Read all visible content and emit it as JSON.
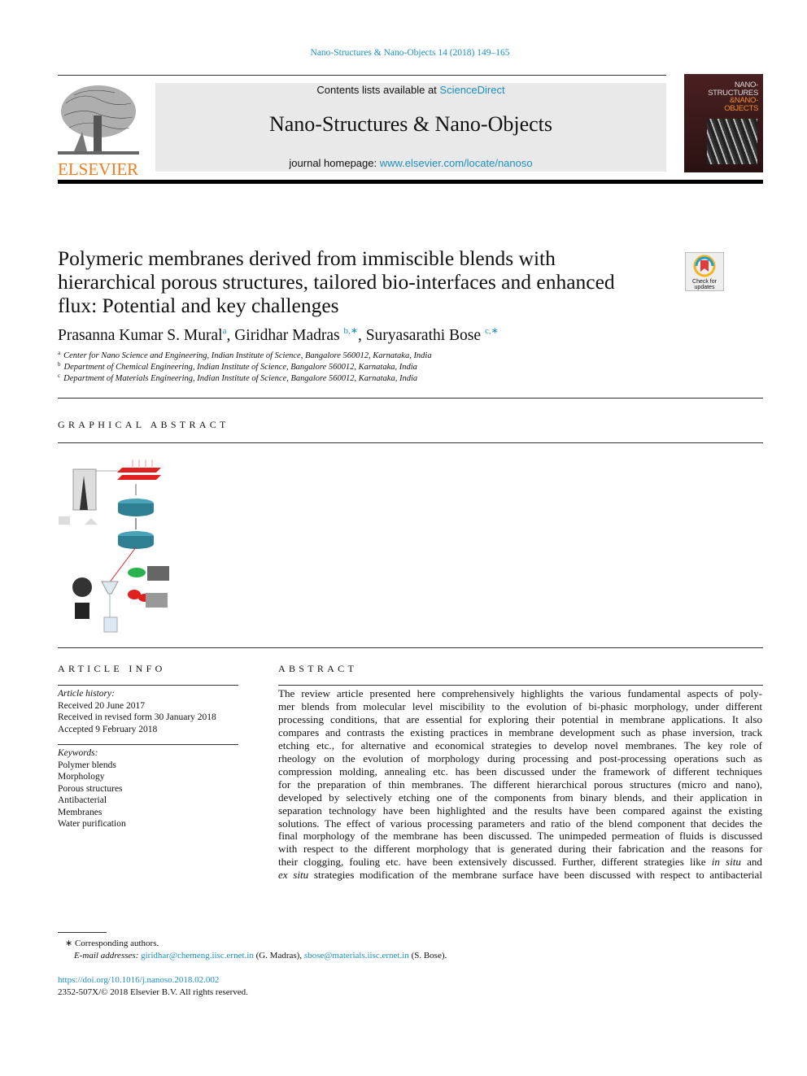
{
  "header": {
    "citation": "Nano-Structures & Nano-Objects 14 (2018) 149–165",
    "contents_prefix": "Contents lists available at ",
    "contents_link": "ScienceDirect",
    "journal_title": "Nano-Structures & Nano-Objects",
    "homepage_prefix": "journal homepage: ",
    "homepage_link": "www.elsevier.com/locate/nanoso",
    "publisher_logo_text": "ELSEVIER",
    "cover_text": [
      "NANO-",
      "STRUCTURES",
      "&NANO-",
      "OBJECTS"
    ],
    "brand_orange": "#f07c1e",
    "link_color": "#1d8fc0"
  },
  "article": {
    "title_lines": [
      "Polymeric membranes derived from immiscible blends with",
      "hierarchical porous structures, tailored bio-interfaces and enhanced",
      "flux: Potential and key challenges"
    ],
    "check_updates": [
      "Check for",
      "updates"
    ],
    "authors": [
      {
        "name": "Prasanna Kumar S. Mural",
        "sup": "a"
      },
      {
        "name": "Giridhar Madras",
        "sup": "b,∗"
      },
      {
        "name": "Suryasarathi Bose",
        "sup": "c,∗"
      }
    ],
    "affiliations": [
      {
        "key": "a",
        "text": "Center for Nano Science and Engineering, Indian Institute of Science, Bangalore 560012, Karnataka, India"
      },
      {
        "key": "b",
        "text": "Department of Chemical Engineering, Indian Institute of Science, Bangalore 560012, Karnataka, India"
      },
      {
        "key": "c",
        "text": "Department of Materials Engineering, Indian Institute of Science, Bangalore 560012, Karnataka, India"
      }
    ]
  },
  "graphical_abstract": {
    "heading": "GRAPHICAL ABSTRACT"
  },
  "article_info": {
    "heading": "ARTICLE INFO",
    "history_label": "Article history:",
    "history": [
      "Received 20 June 2017",
      "Received in revised form 30 January 2018",
      "Accepted 9 February 2018"
    ],
    "keywords_label": "Keywords:",
    "keywords": [
      "Polymer blends",
      "Morphology",
      "Porous structures",
      "Antibacterial",
      "Membranes",
      "Water purification"
    ]
  },
  "abstract": {
    "heading": "ABSTRACT",
    "lines": [
      [
        {
          "t": "The review article presented here comprehensively highlights the various fundamental aspects of poly-"
        }
      ],
      [
        {
          "t": "mer blends from molecular level miscibility to the evolution of bi-phasic morphology, under different"
        }
      ],
      [
        {
          "t": "processing conditions, that are essential for exploring their potential in membrane applications. It also"
        }
      ],
      [
        {
          "t": "compares and contrasts the existing practices in membrane development such as phase inversion, track"
        }
      ],
      [
        {
          "t": "etching etc., for alternative and economical strategies to develop novel membranes. The key role of"
        }
      ],
      [
        {
          "t": "rheology on the evolution of morphology during processing and post-processing operations such as"
        }
      ],
      [
        {
          "t": "compression molding, annealing etc. has been discussed under the framework of different techniques"
        }
      ],
      [
        {
          "t": "for the preparation of thin membranes. The different hierarchical porous structures (micro and nano),"
        }
      ],
      [
        {
          "t": "developed by selectively etching one of the components from binary blends, and their application in"
        }
      ],
      [
        {
          "t": "separation technology have been highlighted and the results have been compared against the existing"
        }
      ],
      [
        {
          "t": "solutions. The effect of various processing parameters and ratio of the blend component that decides the"
        }
      ],
      [
        {
          "t": "final morphology of the membrane has been discussed. The unimpeded permeation of fluids is discussed"
        }
      ],
      [
        {
          "t": "with respect to the different morphology that is generated during their fabrication and the reasons for"
        }
      ],
      [
        {
          "t": "their clogging, fouling etc. have been extensively discussed. Further, different strategies like "
        },
        {
          "t": "in situ",
          "i": true
        },
        {
          "t": " and"
        }
      ],
      [
        {
          "t": "ex situ",
          "i": true
        },
        {
          "t": " strategies modification of the membrane surface have been discussed with respect to antibacterial"
        }
      ]
    ]
  },
  "footnotes": {
    "star": "∗",
    "corresponding": "Corresponding authors.",
    "email_label": "E-mail addresses:",
    "email1": "giridhar@chemeng.iisc.ernet.in",
    "email1_name": " (G. Madras), ",
    "email2": "sbose@materials.iisc.ernet.in",
    "email2_name": " (S. Bose).",
    "doi": "https://doi.org/10.1016/j.nanoso.2018.02.002",
    "copyright": "2352-507X/© 2018 Elsevier B.V. All rights reserved."
  }
}
